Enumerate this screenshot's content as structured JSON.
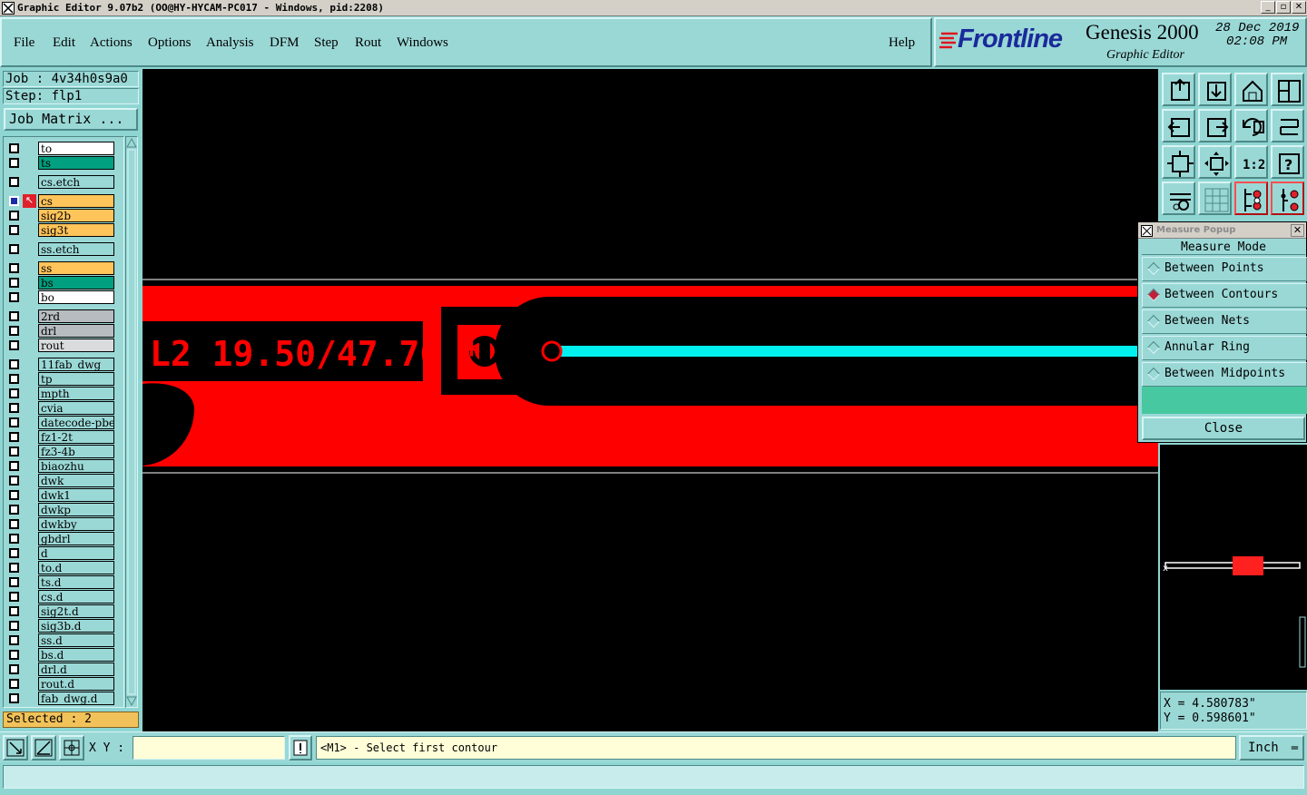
{
  "window": {
    "title": "Graphic Editor 9.07b2 (OO@HY-HYCAM-PC017 - Windows, pid:2208)"
  },
  "menu": [
    "File",
    "Edit",
    "Actions",
    "Options",
    "Analysis",
    "DFM",
    "Step",
    "Rout",
    "Windows"
  ],
  "help": "Help",
  "brand": {
    "logo": "Frontline",
    "product": "Genesis 2000",
    "date": "28 Dec 2019",
    "time": "02:08 PM",
    "subtitle": "Graphic Editor"
  },
  "job": {
    "job_line": "Job : 4v34h0s9a0",
    "step_line": "Step: flp1",
    "matrix_button": "Job Matrix ..."
  },
  "layers": [
    {
      "name": "to",
      "color": "white"
    },
    {
      "name": "ts",
      "color": "green"
    },
    {
      "name": "cs.etch",
      "color": "plain"
    },
    {
      "name": "cs",
      "color": "orange",
      "active": true
    },
    {
      "name": "sig2b",
      "color": "orange"
    },
    {
      "name": "sig3t",
      "color": "orange"
    },
    {
      "name": "ss.etch",
      "color": "plain"
    },
    {
      "name": "ss",
      "color": "orange"
    },
    {
      "name": "bs",
      "color": "green"
    },
    {
      "name": "bo",
      "color": "white"
    },
    {
      "name": "2rd",
      "color": "gray"
    },
    {
      "name": "drl",
      "color": "gray"
    },
    {
      "name": "rout",
      "color": "lgray"
    },
    {
      "name": "11fab_dwg",
      "color": "plain"
    },
    {
      "name": "tp",
      "color": "plain"
    },
    {
      "name": "mpth",
      "color": "plain"
    },
    {
      "name": "cvia",
      "color": "plain"
    },
    {
      "name": "datecode-pbe",
      "color": "plain"
    },
    {
      "name": "fz1-2t",
      "color": "plain"
    },
    {
      "name": "fz3-4b",
      "color": "plain"
    },
    {
      "name": "biaozhu",
      "color": "plain"
    },
    {
      "name": "dwk",
      "color": "plain"
    },
    {
      "name": "dwk1",
      "color": "plain"
    },
    {
      "name": "dwkp",
      "color": "plain"
    },
    {
      "name": "dwkby",
      "color": "plain"
    },
    {
      "name": "gbdrl",
      "color": "plain"
    },
    {
      "name": "d",
      "color": "plain"
    },
    {
      "name": "to.d",
      "color": "plain"
    },
    {
      "name": "ts.d",
      "color": "plain"
    },
    {
      "name": "cs.d",
      "color": "plain"
    },
    {
      "name": "sig2t.d",
      "color": "plain"
    },
    {
      "name": "sig3b.d",
      "color": "plain"
    },
    {
      "name": "ss.d",
      "color": "plain"
    },
    {
      "name": "bs.d",
      "color": "plain"
    },
    {
      "name": "drl.d",
      "color": "plain"
    },
    {
      "name": "rout.d",
      "color": "plain"
    },
    {
      "name": "fab_dwg.d",
      "color": "plain"
    }
  ],
  "selected": "Selected : 2",
  "canvas": {
    "text": "L2 19.50/47.76 *"
  },
  "measure": {
    "title": "Measure Popup",
    "mode_header": "Measure Mode",
    "options": [
      {
        "label": "Between Points",
        "selected": false
      },
      {
        "label": "Between Contours",
        "selected": true
      },
      {
        "label": "Between Nets",
        "selected": false
      },
      {
        "label": "Annular Ring",
        "selected": false
      },
      {
        "label": "Between Midpoints",
        "selected": false
      }
    ],
    "close": "Close"
  },
  "coords": {
    "x": "X = 4.580783\"",
    "y": "Y = 0.598601\""
  },
  "bottom": {
    "xy_label": "X Y :",
    "xy_value": "",
    "prompt": "<M1> - Select first contour",
    "units": "Inch"
  },
  "colors": {
    "copper": "#ff0000",
    "trace": "#00f0f0",
    "panel": "#9ad8d6",
    "canvas": "#000000"
  },
  "toolbar_icons": [
    "pan-up-icon",
    "pan-down-icon",
    "home-icon",
    "split-view-icon",
    "pan-left-icon",
    "pan-right-icon",
    "undo-icon",
    "redo-icon",
    "zoom-fit-icon",
    "zoom-center-icon",
    "scale-1-2-icon",
    "help-icon",
    "tools-icon",
    "grid-icon",
    "layers-snap-icon",
    "net-snap-icon"
  ]
}
